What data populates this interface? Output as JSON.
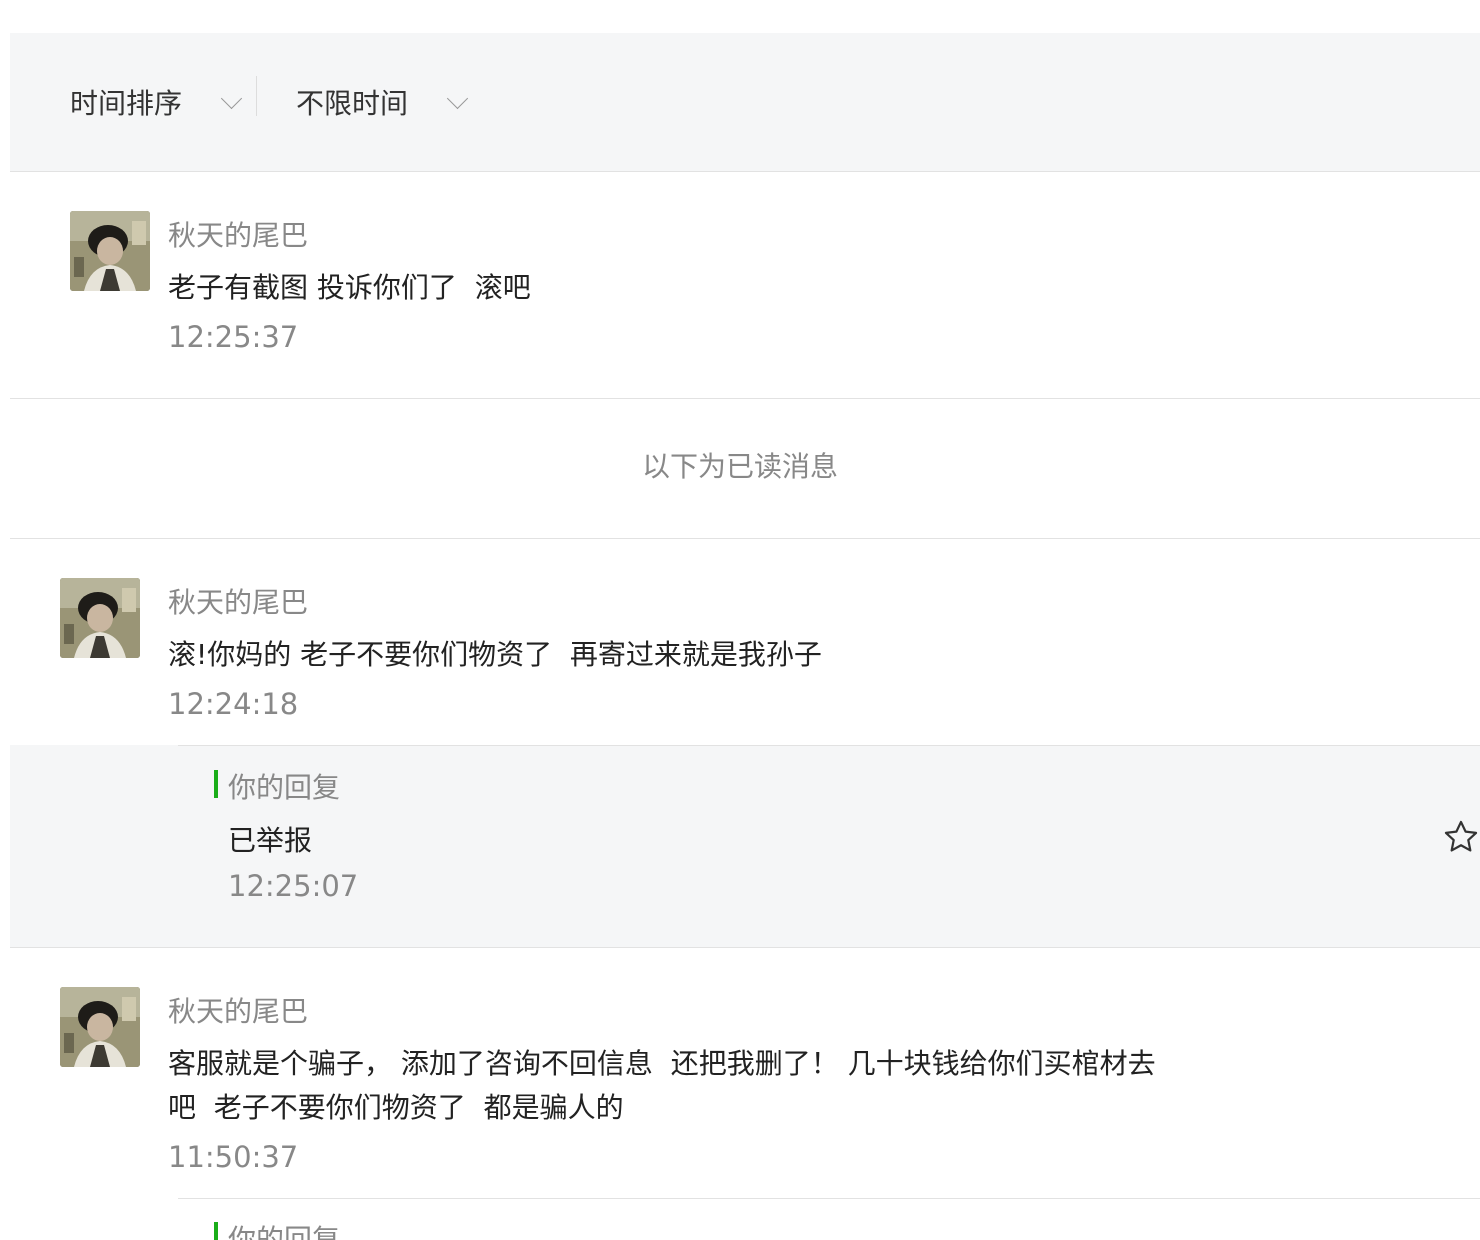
{
  "filters": {
    "sort_label": "时间排序",
    "time_label": "不限时间"
  },
  "read_divider": "以下为已读消息",
  "messages": [
    {
      "nickname": "秋天的尾巴",
      "content": "老子有截图 投诉你们了  滚吧",
      "time": "12:25:37"
    },
    {
      "nickname": "秋天的尾巴",
      "content": "滚!你妈的 老子不要你们物资了  再寄过来就是我孙子",
      "time": "12:24:18",
      "reply": {
        "title": "你的回复",
        "content": "已举报",
        "time": "12:25:07"
      }
    },
    {
      "nickname": "秋天的尾巴",
      "content": "客服就是个骗子， 添加了咨询不回信息  还把我删了！ 几十块钱给你们买棺材去\n吧  老子不要你们物资了  都是骗人的",
      "time": "11:50:37",
      "reply": {
        "title": "你的回复"
      }
    }
  ],
  "icons": {
    "star": "star-outline-icon",
    "chevron": "chevron-down-icon"
  },
  "colors": {
    "reply_accent": "#1aad19",
    "panel_bg": "#f5f6f7"
  }
}
